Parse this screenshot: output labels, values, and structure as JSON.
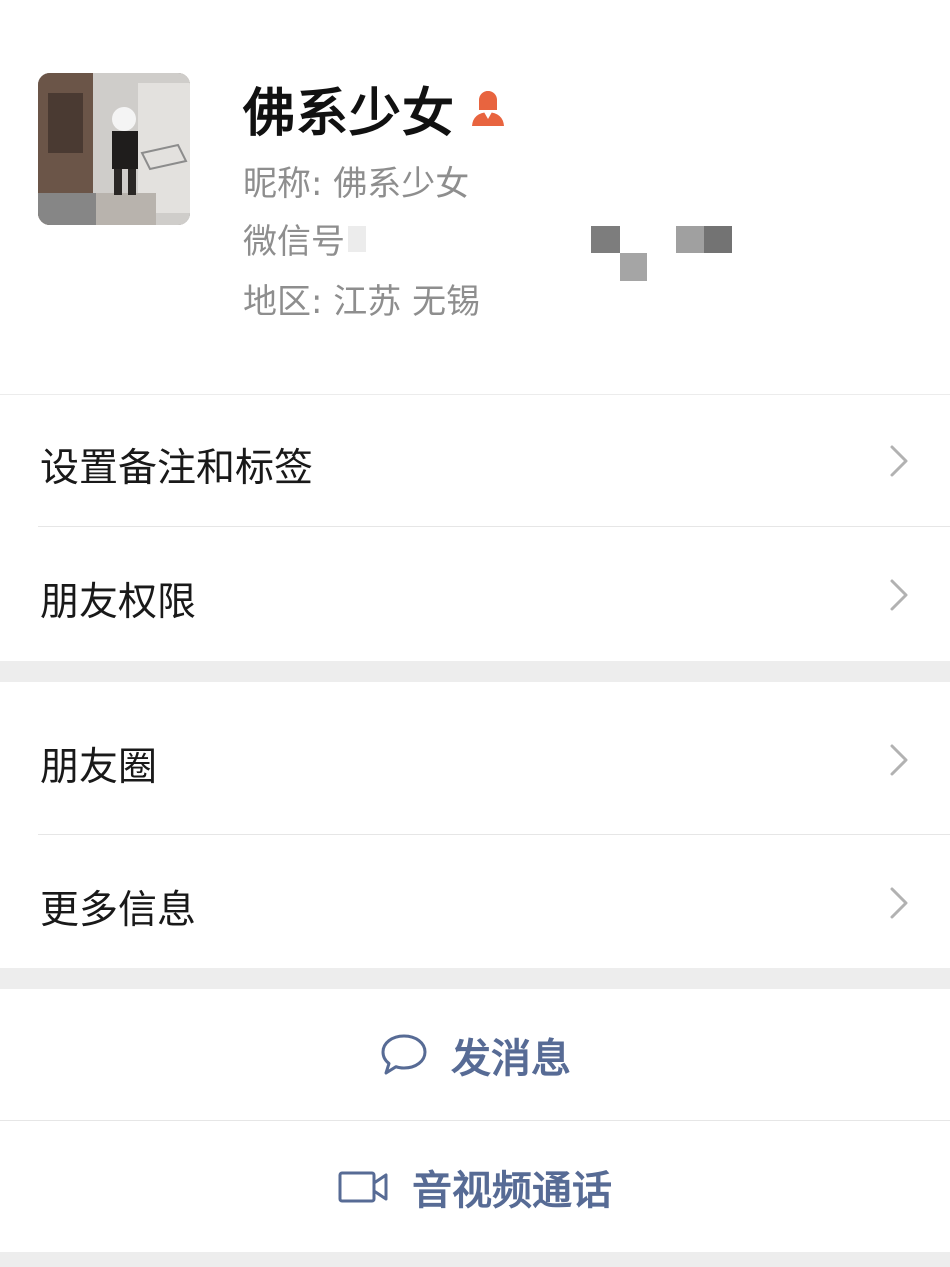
{
  "profile": {
    "display_name": "佛系少女",
    "gender_icon": "female-icon",
    "nickname_label": "昵称: ",
    "nickname_value": "佛系少女",
    "wechat_id_label": "微信号",
    "region_label": "地区: ",
    "region_value": "江苏 无锡"
  },
  "menu_group_1": [
    {
      "label": "设置备注和标签",
      "icon": "chevron-right-icon"
    },
    {
      "label": "朋友权限",
      "icon": "chevron-right-icon"
    }
  ],
  "menu_group_2": [
    {
      "label": "朋友圈",
      "icon": "chevron-right-icon"
    },
    {
      "label": "更多信息",
      "icon": "chevron-right-icon"
    }
  ],
  "actions": {
    "message": {
      "label": "发消息",
      "icon": "chat-bubble-icon"
    },
    "call": {
      "label": "音视频通话",
      "icon": "video-camera-icon"
    }
  },
  "colors": {
    "action_text": "#576b95",
    "gender_icon": "#e8643f",
    "section_gap": "#ededed"
  }
}
